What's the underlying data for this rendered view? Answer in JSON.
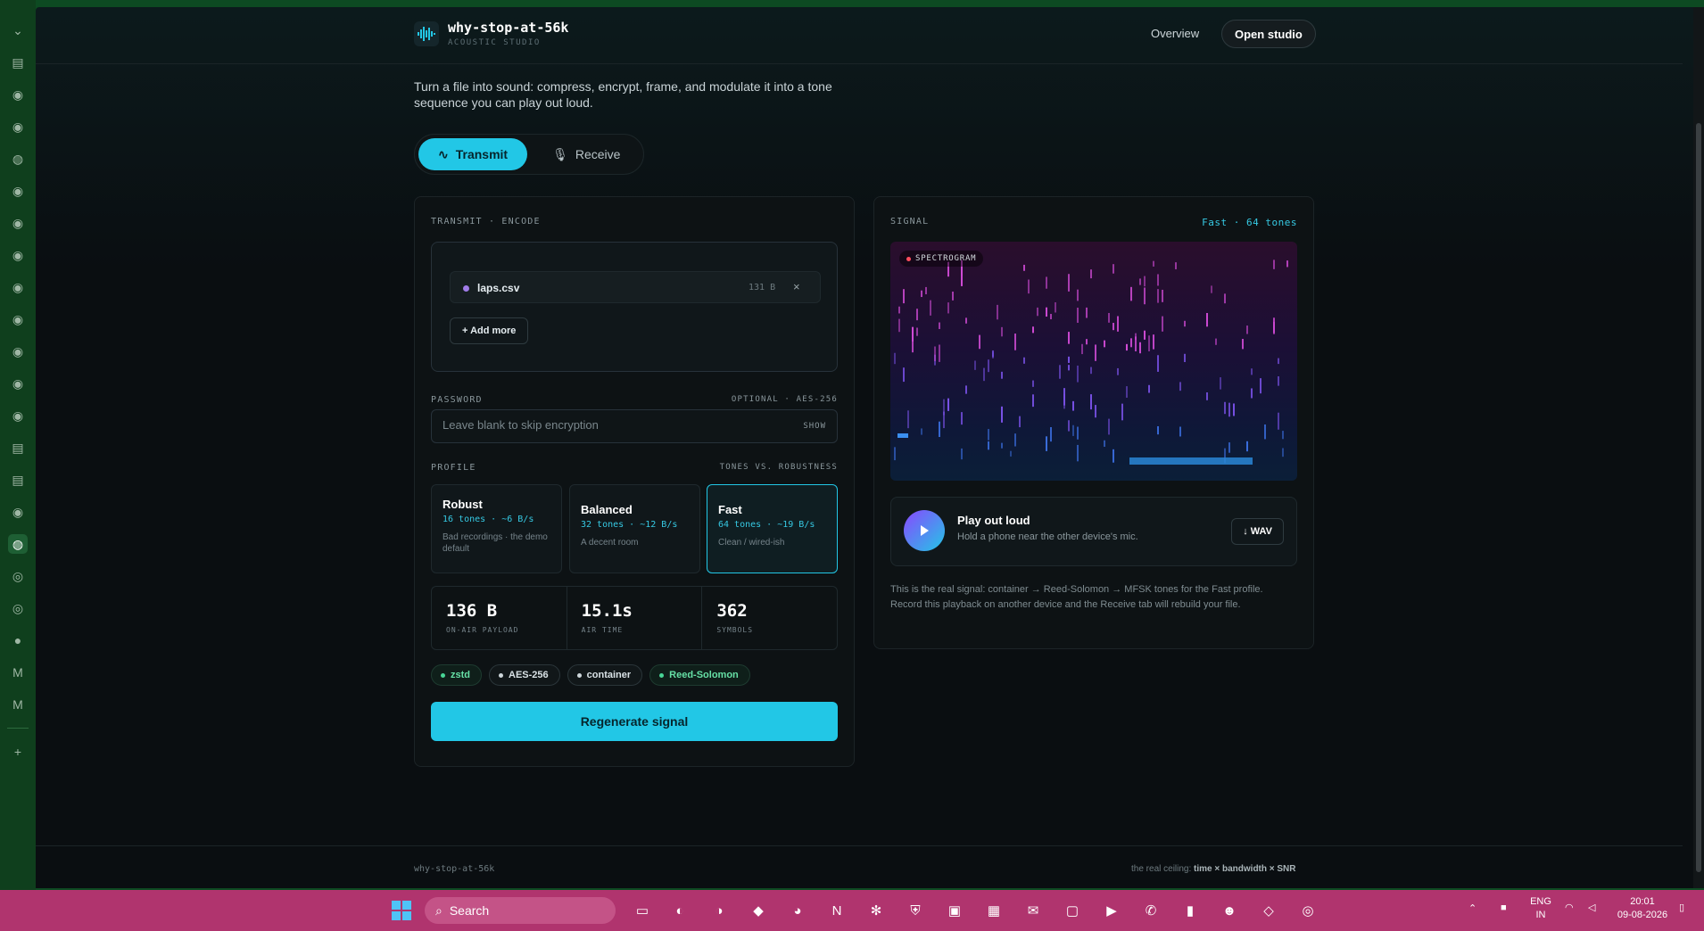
{
  "app": {
    "name": "why-stop-at-56k",
    "subtitle": "ACOUSTIC STUDIO"
  },
  "nav": {
    "overview": "Overview",
    "open_studio": "Open studio"
  },
  "intro": "Turn a file into sound: compress, encrypt, frame, and modulate it into a tone sequence you can play out loud.",
  "modes": {
    "transmit": "Transmit",
    "receive": "Receive"
  },
  "encode": {
    "section_label": "TRANSMIT · ENCODE",
    "file": {
      "name": "laps.csv",
      "size": "131 B",
      "remove": "×"
    },
    "add_more": "+ Add more",
    "password": {
      "label": "PASSWORD",
      "hint": "OPTIONAL · AES-256",
      "placeholder": "Leave blank to skip encryption",
      "show": "SHOW"
    },
    "profile": {
      "label": "PROFILE",
      "hint": "TONES VS. ROBUSTNESS",
      "options": [
        {
          "name": "Robust",
          "meta": "16 tones · ~6 B/s",
          "desc": "Bad recordings · the demo default"
        },
        {
          "name": "Balanced",
          "meta": "32 tones · ~12 B/s",
          "desc": "A decent room"
        },
        {
          "name": "Fast",
          "meta": "64 tones · ~19 B/s",
          "desc": "Clean / wired-ish"
        }
      ],
      "selected": "Fast"
    },
    "stats": [
      {
        "value": "136 B",
        "label": "ON-AIR PAYLOAD"
      },
      {
        "value": "15.1s",
        "label": "AIR TIME"
      },
      {
        "value": "362",
        "label": "SYMBOLS"
      }
    ],
    "chips": [
      "zstd",
      "AES-256",
      "container",
      "Reed-Solomon"
    ],
    "regenerate": "Regenerate signal"
  },
  "signal": {
    "section_label": "SIGNAL",
    "status": "Fast · 64 tones",
    "spectrogram_label": "SPECTROGRAM",
    "play": {
      "title": "Play out loud",
      "subtitle": "Hold a phone near the other device's mic.",
      "wav": "↓ WAV"
    },
    "note": "This is the real signal: container → Reed-Solomon → MFSK tones for the Fast profile. Record this playback on another device and the Receive tab will rebuild your file."
  },
  "footer": {
    "left": "why-stop-at-56k",
    "right_prefix": "the real ceiling: ",
    "right_bold": "time × bandwidth × SNR"
  },
  "taskbar": {
    "search": "Search",
    "lang1": "ENG",
    "lang2": "IN",
    "time": "20:01",
    "date": "09-08-2026"
  },
  "colors": {
    "accent": "#22c7e6",
    "taskbar": "#b0346e",
    "sidebar": "#0f3f1d"
  }
}
